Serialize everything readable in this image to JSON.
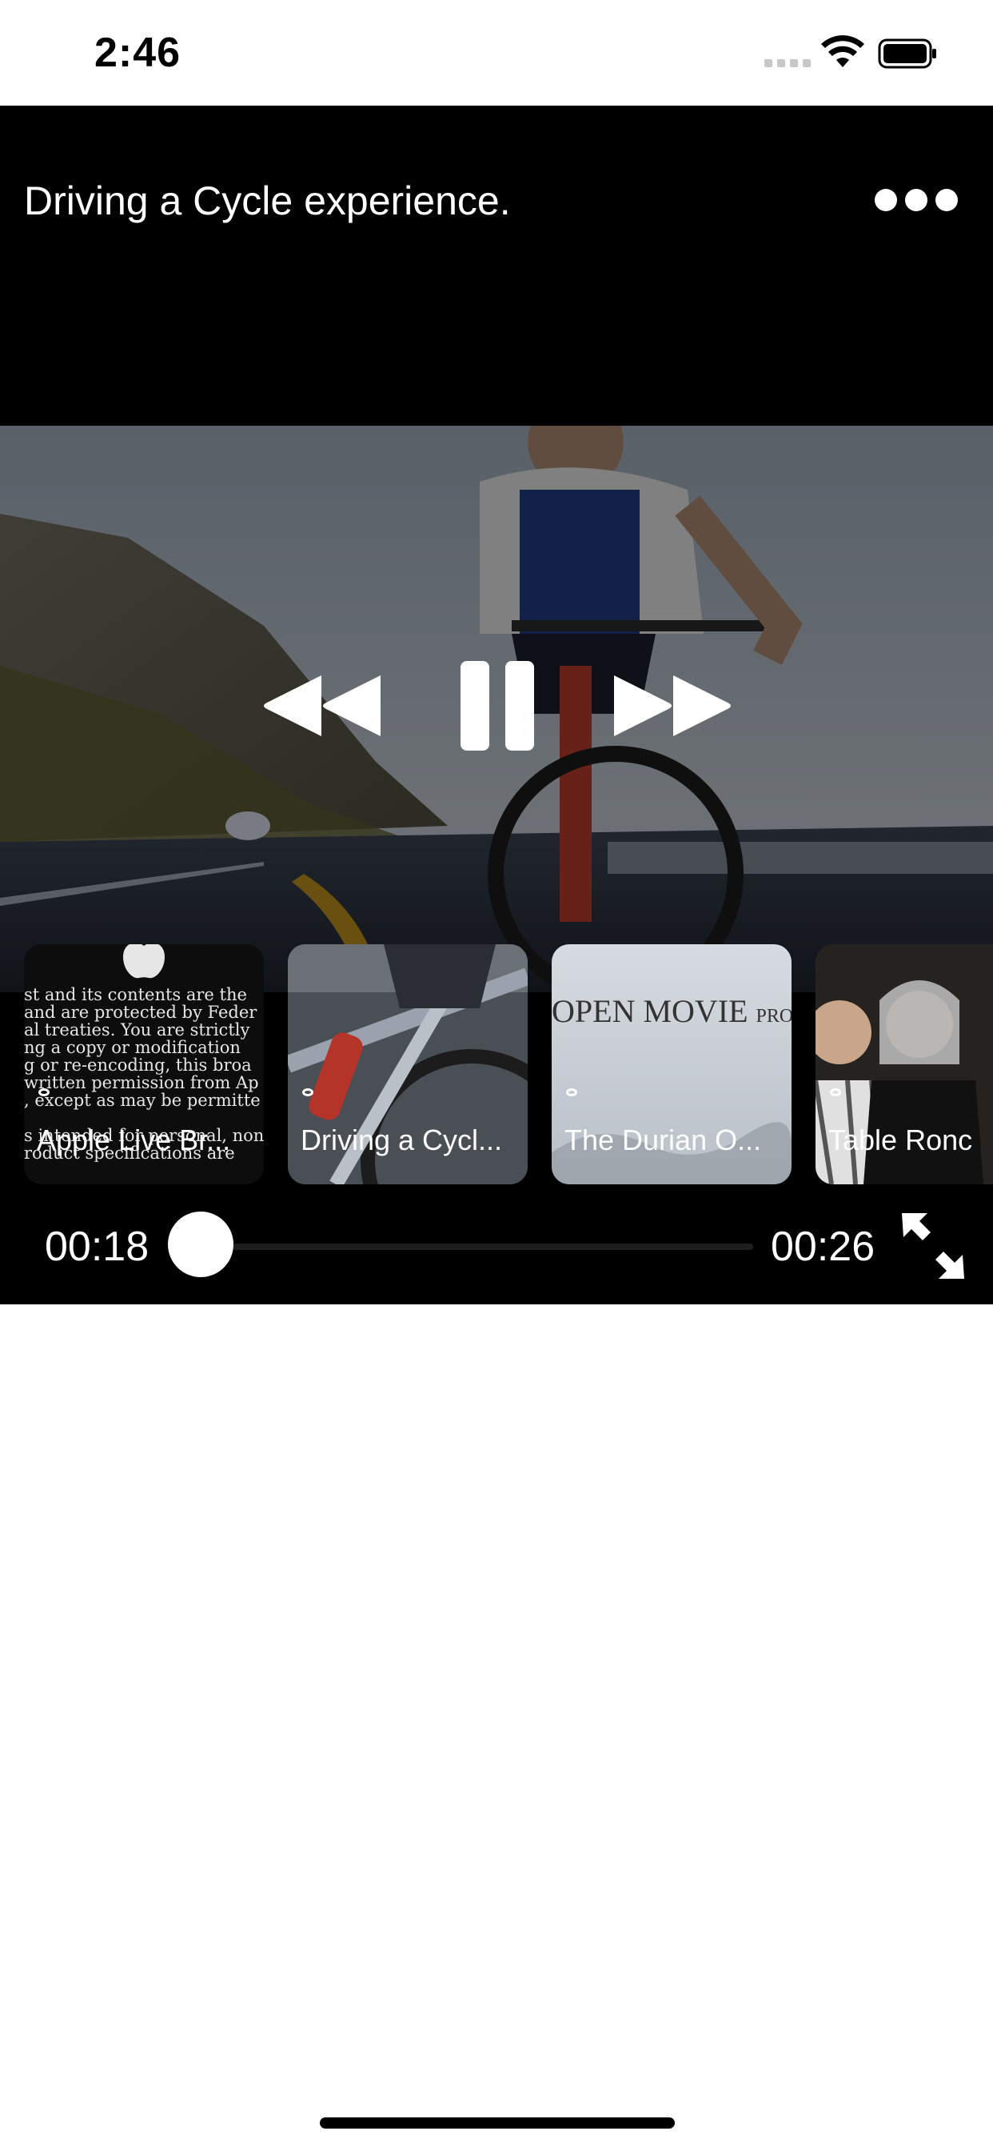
{
  "status_bar": {
    "time": "2:46",
    "icons": [
      "signal-icon",
      "wifi-icon",
      "battery-icon"
    ]
  },
  "player": {
    "title": "Driving a Cycle experience.",
    "more_icon": "ellipsis-icon",
    "controls": {
      "rewind_icon": "rewind-icon",
      "pause_icon": "pause-icon",
      "forward_icon": "fast-forward-icon"
    },
    "playlist": [
      {
        "label": "Apple Live Br...",
        "preview_lines": [
          "st and its contents are the",
          " and are protected by Feder",
          "al treaties.  You are strictly",
          "ng a copy or modification",
          "g or re-encoding, this broa",
          "written permission from Ap",
          ", except as may be permitte",
          "",
          "s intended for personal, non",
          "roduct specifications  are"
        ]
      },
      {
        "label": "Driving a Cycl..."
      },
      {
        "label": "The Durian O...",
        "preview_text": "OPEN MOVIE",
        "preview_small": "PROJECT"
      },
      {
        "label": "Table Ronc"
      }
    ],
    "progress": {
      "current_time": "00:18",
      "total_time": "00:26",
      "position_fraction": 0.0
    },
    "fullscreen_icon": "expand-icon"
  },
  "colors": {
    "player_background": "#000000",
    "page_background": "#ffffff",
    "control_color": "#ffffff"
  }
}
